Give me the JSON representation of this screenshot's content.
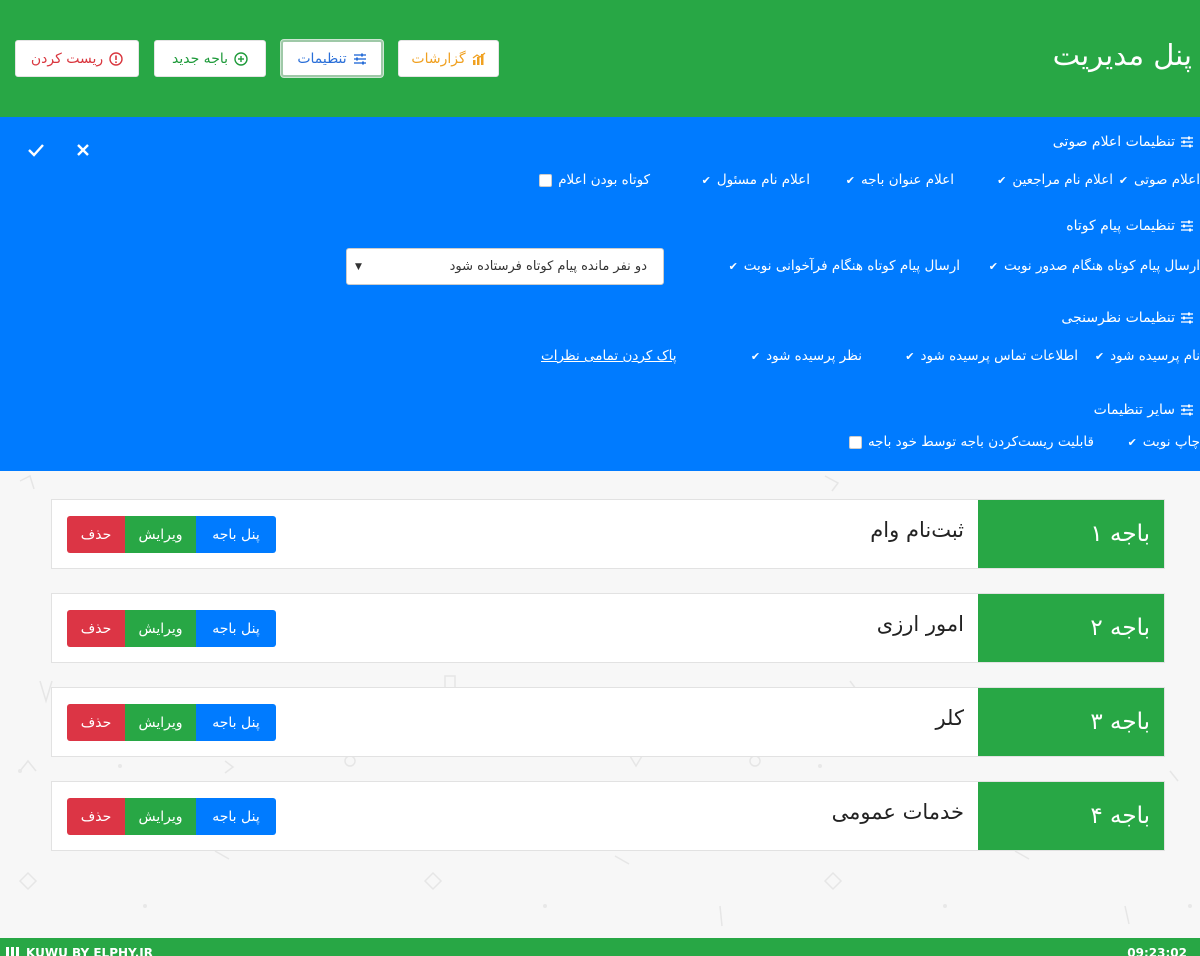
{
  "header": {
    "title": "پنل مدیریت",
    "buttons": {
      "reports": "گزارشات",
      "settings": "تنظیمات",
      "new_counter": "باجه جدید",
      "reset": "ریست کردن"
    },
    "icons": {
      "reports": "chart-icon",
      "settings": "sliders-icon",
      "new_counter": "plus-circle-icon",
      "reset": "alert-circle-icon"
    }
  },
  "settings": {
    "audio": {
      "title": "تنظیمات اعلام صوتی",
      "options": [
        "اعلام صوتی",
        "اعلام نام مراجعین",
        "اعلام عنوان باجه",
        "اعلام نام مسئول",
        "کوتاه بودن اعلام"
      ]
    },
    "sms": {
      "title": "تنظیمات پیام کوتاه",
      "options": [
        "ارسال پیام کوتاه هنگام صدور نوبت",
        "ارسال پیام کوتاه هنگام فرآخوانی نوبت"
      ],
      "select_value": "دو نفر مانده پیام کوتاه فرستاده شود"
    },
    "survey": {
      "title": "تنظیمات نظرسنجی",
      "options": [
        "نام پرسیده شود",
        "اطلاعات تماس پرسیده شود",
        "نظر پرسیده شود"
      ],
      "clear_link": "پاک کردن تمامی نظرات"
    },
    "other": {
      "title": "سایر تنظیمات",
      "options": [
        "چاپ نوبت",
        "قابلیت ریست‌کردن باجه توسط خود باجه"
      ]
    },
    "check_glyph": "✔",
    "confirm_icon": "check-icon",
    "close_icon": "close-icon"
  },
  "counters": [
    {
      "id_label": "باجه ۱",
      "name": "ثبت‌نام وام"
    },
    {
      "id_label": "باجه ۲",
      "name": "امور ارزی"
    },
    {
      "id_label": "باجه ۳",
      "name": "کلر"
    },
    {
      "id_label": "باجه ۴",
      "name": "خدمات عمومی"
    }
  ],
  "counter_actions": {
    "panel": "پنل باجه",
    "edit": "ویرایش",
    "delete": "حذف"
  },
  "footer": {
    "brand": "KUWU BY ELPHY.IR",
    "time": "09:23:02"
  },
  "colors": {
    "header_green": "#28a745",
    "panel_blue": "#007bff",
    "danger_red": "#dc3545"
  }
}
